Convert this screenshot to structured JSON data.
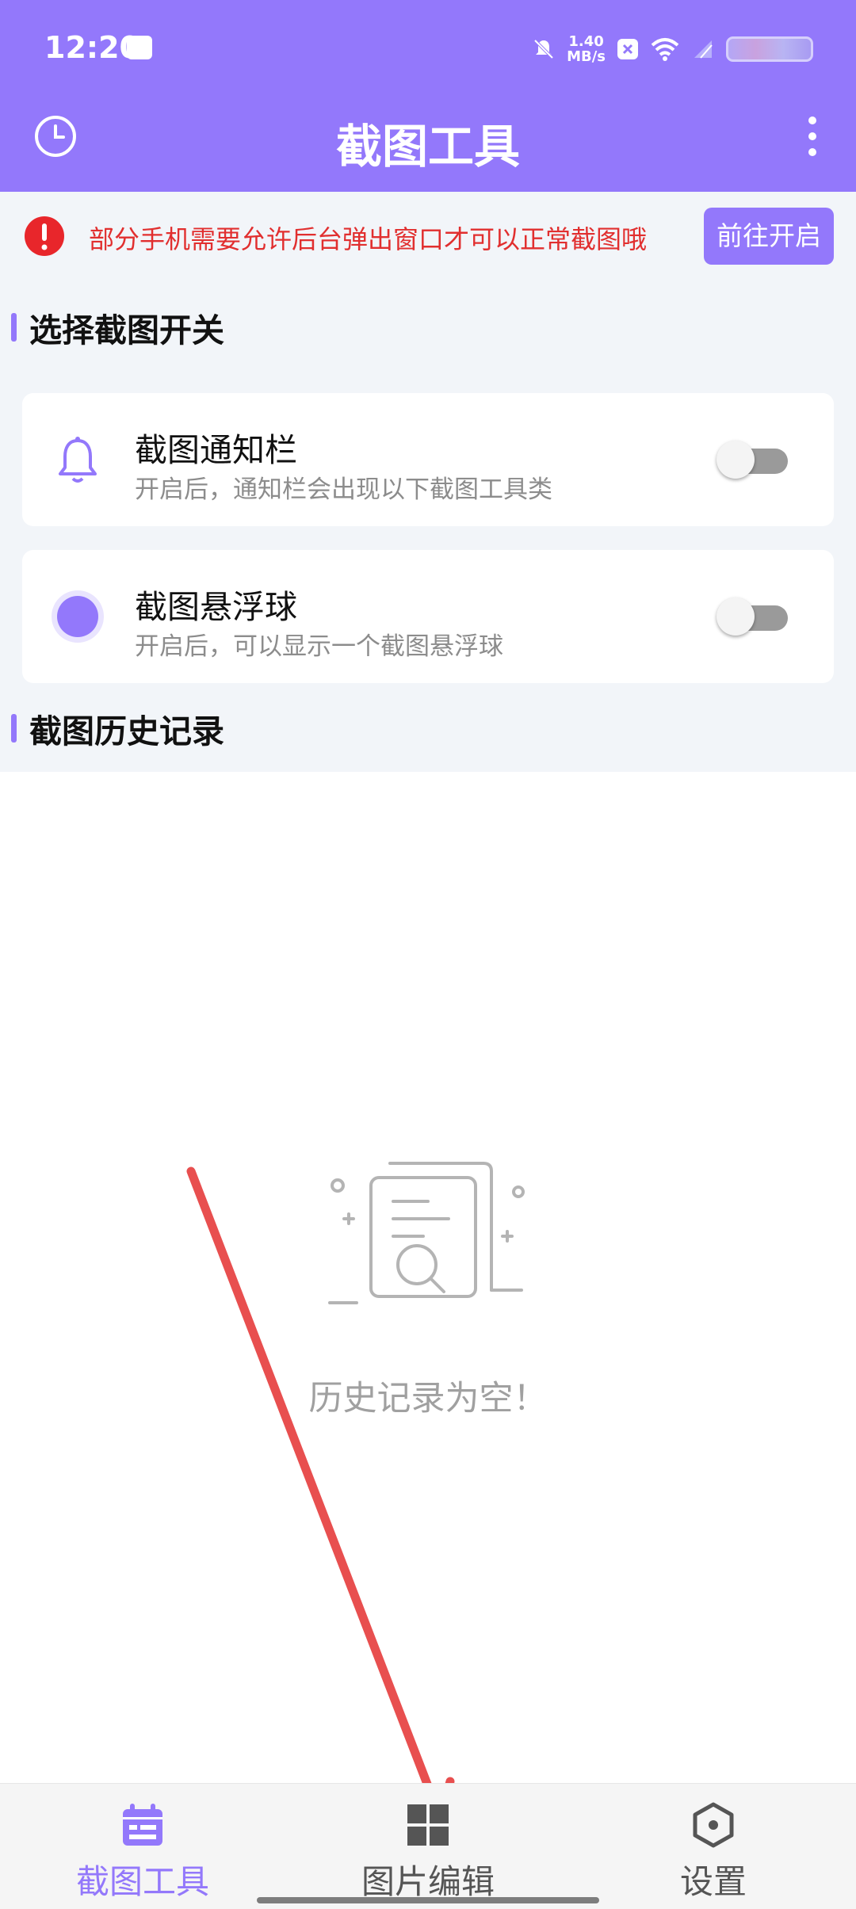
{
  "status_bar": {
    "time": "12:20",
    "speed_value": "1.40",
    "speed_unit": "MB/s"
  },
  "app_bar": {
    "title": "截图工具"
  },
  "notice": {
    "text": "部分手机需要允许后台弹出窗口才可以正常截图哦",
    "button_label": "前往开启"
  },
  "sections": {
    "switches_title": "选择截图开关",
    "history_title": "截图历史记录"
  },
  "cards": [
    {
      "title": "截图通知栏",
      "description": "开启后，通知栏会出现以下截图工具类",
      "icon": "bell-icon",
      "enabled": false
    },
    {
      "title": "截图悬浮球",
      "description": "开启后，可以显示一个截图悬浮球",
      "icon": "floating-ball-icon",
      "enabled": false
    }
  ],
  "history": {
    "empty_text": "历史记录为空！"
  },
  "bottom_nav": [
    {
      "label": "截图工具",
      "icon": "calendar-icon",
      "active": true
    },
    {
      "label": "图片编辑",
      "icon": "grid-icon",
      "active": false
    },
    {
      "label": "设置",
      "icon": "hexagon-settings-icon",
      "active": false
    }
  ],
  "colors": {
    "accent": "#9378fb",
    "warning": "#e12f2f",
    "annotation_arrow": "#e84f4f",
    "inactive": "#555555"
  }
}
